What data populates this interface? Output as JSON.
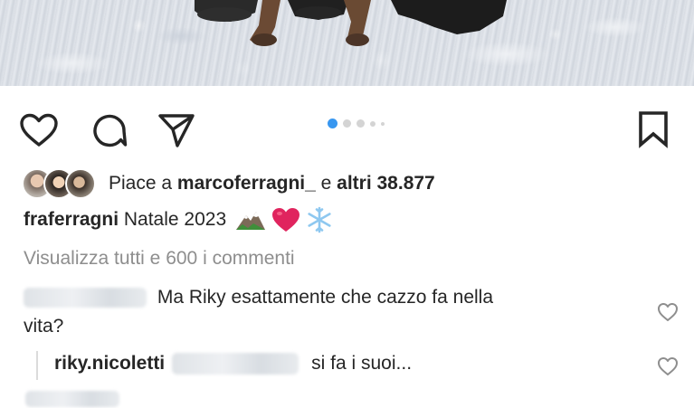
{
  "post": {
    "photo_description_icon": "snow-photo"
  },
  "actions": {
    "like_icon": "heart-icon",
    "comment_icon": "comment-icon",
    "share_icon": "paper-plane-icon",
    "save_icon": "bookmark-icon",
    "carousel": {
      "total_dots": 5,
      "active_index": 0
    }
  },
  "likes": {
    "prefix": "Piace a ",
    "user": "marcoferragni_",
    "middle": " e ",
    "others": "altri 38.877"
  },
  "caption": {
    "username": "fraferragni",
    "text": " Natale 2023",
    "emojis": [
      "mountain-emoji",
      "red-heart-emoji",
      "snowflake-emoji"
    ]
  },
  "comments": {
    "view_all": "Visualizza tutti e 600 i commenti",
    "items": [
      {
        "text_line1": "Ma Riky esattamente che cazzo fa nella",
        "text_line2": "vita?"
      }
    ],
    "replies": [
      {
        "username": "riky.nicoletti",
        "text": "si fa i suoi..."
      }
    ]
  },
  "colors": {
    "text": "#262626",
    "muted": "#8e8e8e",
    "accent": "#3897f0",
    "heart_red": "#e0245e"
  }
}
